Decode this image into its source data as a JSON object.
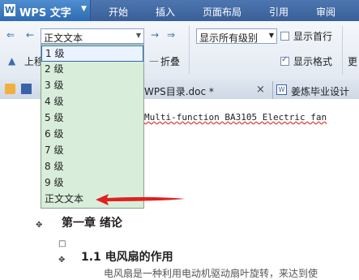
{
  "app": {
    "title": "WPS 文字",
    "logo": "W"
  },
  "menu": {
    "tabs": [
      "开始",
      "插入",
      "页面布局",
      "引用",
      "审阅"
    ]
  },
  "ribbon": {
    "style_combo": "正文文本",
    "level_combo": "显示所有级别",
    "show_first_line": "显示首行",
    "show_format": "显示格式",
    "move_up": "上移",
    "collapse": "折叠",
    "show_first_line_checked": false,
    "show_format_checked": true,
    "cut_char": "更"
  },
  "tabs": {
    "doc1": "WPS目录.doc *",
    "doc2": "姜炼毕业设计",
    "close": "×"
  },
  "dropdown": {
    "items": [
      "1 级",
      "2 级",
      "3 级",
      "4 级",
      "5 级",
      "6 级",
      "7 级",
      "8 级",
      "9 级",
      "正文文本"
    ],
    "selected_index": 0
  },
  "document": {
    "line1": "Multi-function  BA3105  Electric fan",
    "heading1": "第一章  绪论",
    "heading2": "1.1 电风扇的作用",
    "body_partial": "电风扇是一种利用电动机驱动扇叶旋转，来达到使"
  },
  "colors": {
    "menubar": "#3a5f98",
    "dropdown_bg": "#d8eeda",
    "arrow": "#e02020"
  }
}
